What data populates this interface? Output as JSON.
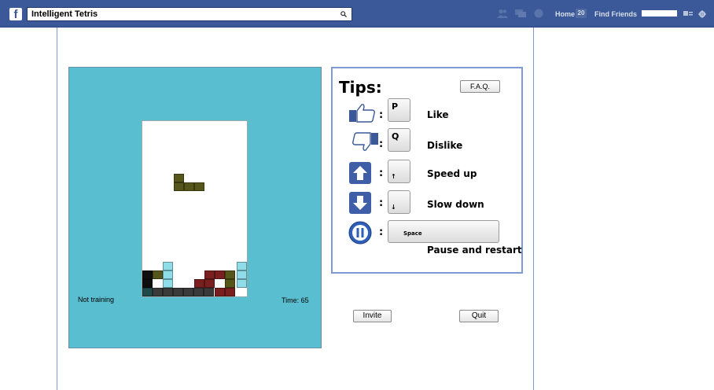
{
  "topbar": {
    "search_value": "Intelligent Tetris",
    "home_label": "Home",
    "home_count": "20",
    "find_friends_label": "Find Friends"
  },
  "game": {
    "status_text": "Not training",
    "time_label": "Time: 65",
    "colors": {
      "background": "#59bfd0",
      "olive": "#56561a",
      "cyan": "#8fdde8",
      "maroon": "#7a1f1f",
      "dark": "#3a3a3a",
      "black": "#0e0e0e"
    }
  },
  "tips": {
    "title": "Tips:",
    "faq_label": "F.A.Q.",
    "items": [
      {
        "icon": "thumbs-up-icon",
        "key": "P",
        "label": "Like"
      },
      {
        "icon": "thumbs-down-icon",
        "key": "Q",
        "label": "Dislike"
      },
      {
        "icon": "arrow-up-icon",
        "key": "↑",
        "label": "Speed up"
      },
      {
        "icon": "arrow-down-icon",
        "key": "↓",
        "label": "Slow down"
      },
      {
        "icon": "pause-icon",
        "key": "Space",
        "label": "Pause and restart"
      }
    ]
  },
  "actions": {
    "invite_label": "Invite",
    "quit_label": "Quit"
  }
}
